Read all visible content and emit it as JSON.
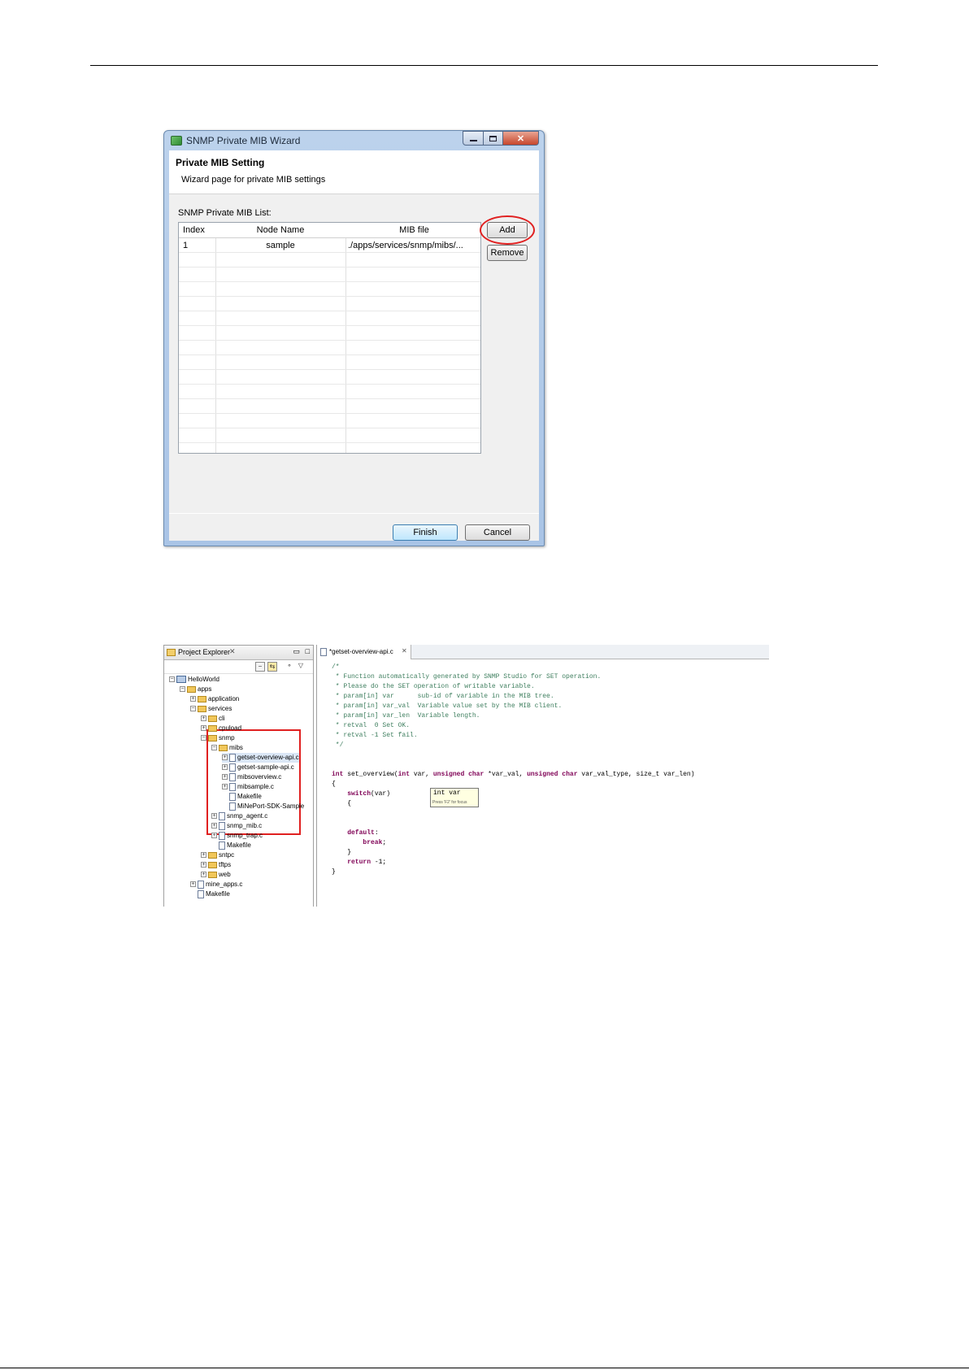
{
  "wizard": {
    "window_title": "SNMP Private MIB Wizard",
    "close_glyph": "✕",
    "page_title": "Private MIB Setting",
    "page_description": "Wizard page for private MIB settings",
    "list_label": "SNMP Private MIB List:",
    "columns": [
      "Index",
      "Node Name",
      "MIB file"
    ],
    "rows": [
      {
        "index": "1",
        "node_name": "sample",
        "mib_file": "./apps/services/snmp/mibs/..."
      }
    ],
    "add_label": "Add",
    "remove_label": "Remove",
    "finish_label": "Finish",
    "cancel_label": "Cancel",
    "add_highlight_color": "#e02020"
  },
  "ide": {
    "explorer_tab": "Project Explorer",
    "editor_tab": "*getset-overview-api.c",
    "tree": [
      {
        "label": "HelloWorld",
        "depth": 0,
        "icon": "project-icon",
        "twisty": "−"
      },
      {
        "label": "apps",
        "depth": 1,
        "icon": "folder-icon",
        "twisty": "−"
      },
      {
        "label": "application",
        "depth": 2,
        "icon": "folder-icon",
        "twisty": "+"
      },
      {
        "label": "services",
        "depth": 2,
        "icon": "folder-icon",
        "twisty": "−"
      },
      {
        "label": "cli",
        "depth": 3,
        "icon": "folder-icon",
        "twisty": "+"
      },
      {
        "label": "cpuload",
        "depth": 3,
        "icon": "folder-icon",
        "twisty": "+"
      },
      {
        "label": "snmp",
        "depth": 3,
        "icon": "folder-icon",
        "twisty": "−"
      },
      {
        "label": "mibs",
        "depth": 4,
        "icon": "folder-icon",
        "twisty": "−"
      },
      {
        "label": "getset-overview-api.c",
        "depth": 5,
        "icon": "c-file-icon",
        "twisty": "+",
        "selected": true
      },
      {
        "label": "getset-sample-api.c",
        "depth": 5,
        "icon": "c-file-icon",
        "twisty": "+"
      },
      {
        "label": "mibsoverview.c",
        "depth": 5,
        "icon": "c-file-icon",
        "twisty": "+"
      },
      {
        "label": "mibsample.c",
        "depth": 5,
        "icon": "c-file-icon",
        "twisty": "+"
      },
      {
        "label": "Makefile",
        "depth": 5,
        "icon": "file-icon",
        "twisty": ""
      },
      {
        "label": "MiNePort-SDK-Sample",
        "depth": 5,
        "icon": "file-icon",
        "twisty": ""
      },
      {
        "label": "snmp_agent.c",
        "depth": 4,
        "icon": "c-file-icon",
        "twisty": "+"
      },
      {
        "label": "snmp_mib.c",
        "depth": 4,
        "icon": "c-file-icon",
        "twisty": "+"
      },
      {
        "label": "snmp_trap.c",
        "depth": 4,
        "icon": "c-file-icon",
        "twisty": "+"
      },
      {
        "label": "Makefile",
        "depth": 4,
        "icon": "file-icon",
        "twisty": ""
      },
      {
        "label": "sntpc",
        "depth": 3,
        "icon": "folder-icon",
        "twisty": "+"
      },
      {
        "label": "tftps",
        "depth": 3,
        "icon": "folder-icon",
        "twisty": "+"
      },
      {
        "label": "web",
        "depth": 3,
        "icon": "folder-icon",
        "twisty": "+"
      },
      {
        "label": "mine_apps.c",
        "depth": 2,
        "icon": "c-file-icon",
        "twisty": "+"
      },
      {
        "label": "Makefile",
        "depth": 2,
        "icon": "file-icon",
        "twisty": ""
      }
    ],
    "code_lines": [
      {
        "text": "/*",
        "cls": "cm"
      },
      {
        "text": " * Function automatically generated by SNMP Studio for SET operation.",
        "cls": "cm"
      },
      {
        "text": " * Please do the SET operation of writable variable.",
        "cls": "cm"
      },
      {
        "text": " * param[in] var      sub-id of variable in the MIB tree.",
        "cls": "cm"
      },
      {
        "text": " * param[in] var_val  Variable value set by the MIB client.",
        "cls": "cm"
      },
      {
        "text": " * param[in] var_len  Variable length.",
        "cls": "cm"
      },
      {
        "text": " * retval  0 Set OK.",
        "cls": "cm"
      },
      {
        "text": " * retval -1 Set fail.",
        "cls": "cm"
      },
      {
        "text": " */",
        "cls": "cm"
      },
      {
        "text": "",
        "cls": ""
      },
      {
        "text": "",
        "cls": ""
      },
      {
        "text": "int set_overview(int var, unsigned char *var_val, unsigned char var_val_type, size_t var_len)",
        "cls": "sig"
      },
      {
        "text": "{",
        "cls": ""
      },
      {
        "text": "    switch(var)",
        "cls": "sw"
      },
      {
        "text": "    {",
        "cls": ""
      },
      {
        "text": "",
        "cls": ""
      },
      {
        "text": "",
        "cls": ""
      },
      {
        "text": "    default:",
        "cls": "kwline"
      },
      {
        "text": "        break;",
        "cls": "kwline"
      },
      {
        "text": "    }",
        "cls": ""
      },
      {
        "text": "    return -1;",
        "cls": "ret"
      },
      {
        "text": "}",
        "cls": ""
      }
    ],
    "hover_code": "int var",
    "hover_hint": "Press 'F2' for focus",
    "highlight_color": "#e02020"
  }
}
